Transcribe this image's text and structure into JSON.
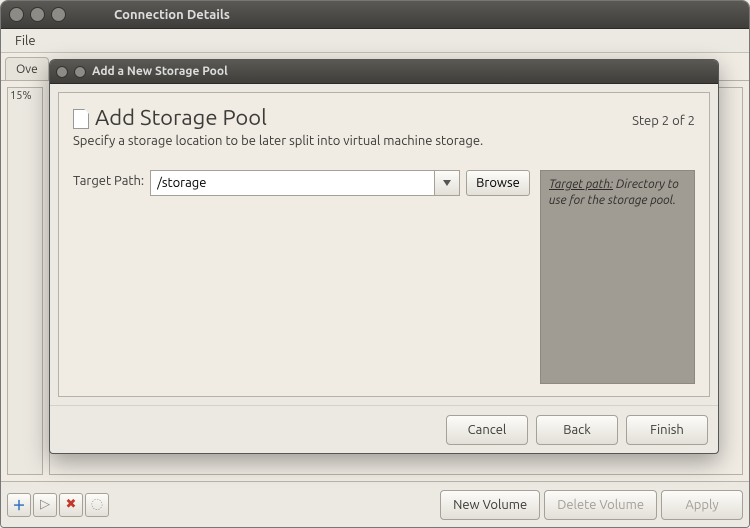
{
  "parent": {
    "title": "Connection Details",
    "menubar": {
      "file": "File"
    },
    "tab": "Ove",
    "side_value": "15%",
    "bottombar": {
      "buttons": {
        "new_volume": "New Volume",
        "delete_volume": "Delete Volume",
        "apply": "Apply"
      },
      "icons": {
        "add": "＋",
        "play": "▷",
        "delete": "✖",
        "props": "◌"
      }
    }
  },
  "dialog": {
    "title": "Add a New Storage Pool",
    "heading": "Add Storage Pool",
    "step": "Step 2 of 2",
    "subtitle": "Specify a storage location to be later split into virtual machine storage.",
    "field": {
      "label": "Target Path:",
      "value": "/storage",
      "browse": "Browse"
    },
    "help": {
      "title": "Target path:",
      "body": "Directory to use for the storage pool."
    },
    "buttons": {
      "cancel": "Cancel",
      "back": "Back",
      "finish": "Finish"
    }
  }
}
